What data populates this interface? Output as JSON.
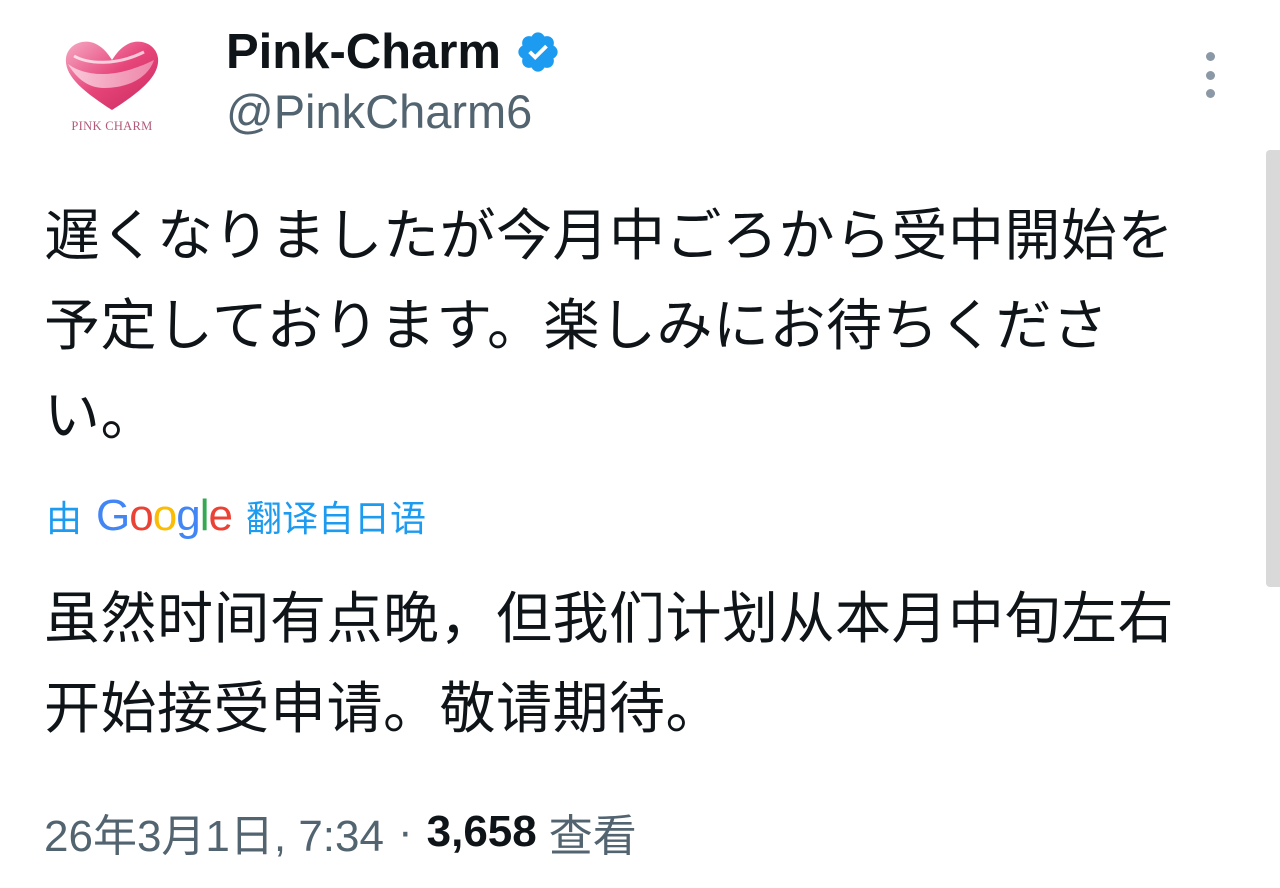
{
  "author": {
    "display_name": "Pink-Charm",
    "handle": "@PinkCharm6",
    "verified": true,
    "avatar_icon": "heart-ribbon-logo",
    "avatar_logo_text": "PINK CHARM"
  },
  "more_icon": "more-vertical-icon",
  "tweet": {
    "text": "遅くなりましたが今月中ごろから受中開始を予定しております。楽しみにお待ちください。",
    "translate": {
      "prefix": "由",
      "provider": "Google",
      "suffix": "翻译自日语"
    },
    "translated_text": "虽然时间有点晚，但我们计划从本月中旬左右开始接受申请。敬请期待。"
  },
  "meta": {
    "timestamp": "26年3月1日, 7:34",
    "separator": "·",
    "views_count": "3,658",
    "views_label": "查看"
  },
  "colors": {
    "verified_blue": "#1d9bf0",
    "link_blue": "#1d9bf0",
    "secondary_text": "#536471",
    "primary_text": "#0f1419",
    "brand_pink": "#e6457a"
  }
}
